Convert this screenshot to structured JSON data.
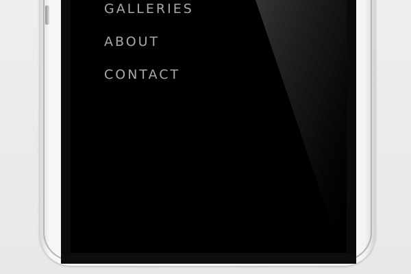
{
  "nav": {
    "items": [
      {
        "label": "GALLERIES"
      },
      {
        "label": "ABOUT"
      },
      {
        "label": "CONTACT"
      }
    ]
  },
  "colors": {
    "background": "#ebebeb",
    "screen": "#000000",
    "menu_text": "#a9a9a9",
    "phone_body": "#ffffff"
  },
  "device": {
    "type": "smartphone",
    "color": "white"
  }
}
